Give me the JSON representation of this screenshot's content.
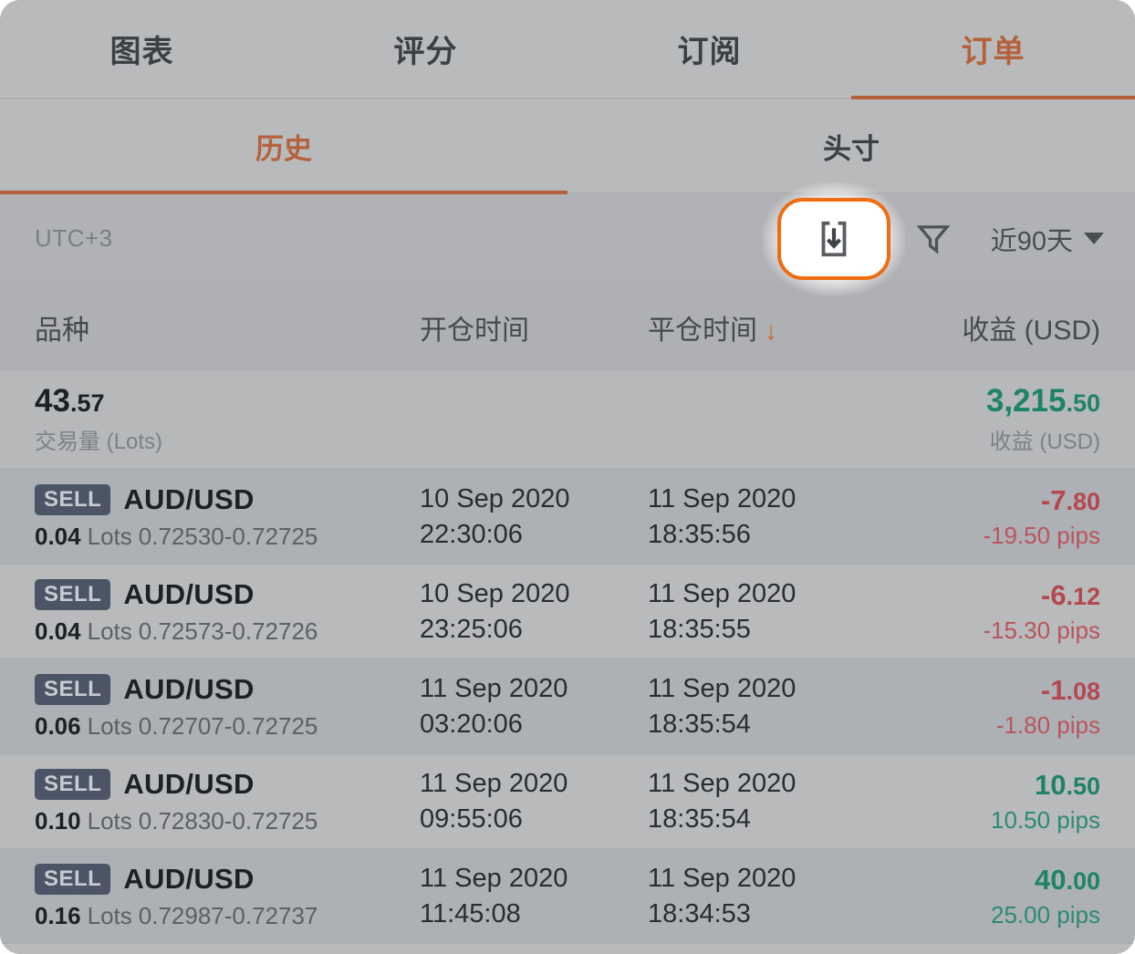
{
  "colors": {
    "accent_orange": "#b4613c",
    "highlight_orange": "#ef6c11",
    "profit_green": "#1f8368",
    "loss_red": "#b5484f",
    "badge_bg": "#4b5566",
    "panel_bg": "#b8babb"
  },
  "tabs": [
    {
      "label": "图表",
      "active": false
    },
    {
      "label": "评分",
      "active": false
    },
    {
      "label": "订阅",
      "active": false
    },
    {
      "label": "订单",
      "active": true
    }
  ],
  "subtabs": [
    {
      "label": "历史",
      "active": true
    },
    {
      "label": "头寸",
      "active": false
    }
  ],
  "toolbar": {
    "timezone": "UTC+3",
    "export_icon": "download-box-icon",
    "filter_icon": "funnel-icon",
    "range_label": "近90天",
    "caret_icon": "chevron-down-icon"
  },
  "columns": {
    "symbol": "品种",
    "open_time": "开仓时间",
    "close_time": "平仓时间",
    "sort_indicator": "↓",
    "profit": "收益 (USD)"
  },
  "summary": {
    "volume_value_int": "43",
    "volume_value_dec": ".57",
    "volume_label": "交易量 (Lots)",
    "profit_value_int": "3,215",
    "profit_value_dec": ".50",
    "profit_label": "收益 (USD)"
  },
  "rows": [
    {
      "side": "SELL",
      "symbol": "AUD/USD",
      "lots": "0.04",
      "lots_word": "Lots",
      "prices": "0.72530-0.72725",
      "open_date": "10 Sep 2020",
      "open_time": "22:30:06",
      "close_date": "11 Sep 2020",
      "close_time": "18:35:56",
      "profit_int": "-7",
      "profit_dec": ".80",
      "pips": "-19.50 pips",
      "sign": "neg"
    },
    {
      "side": "SELL",
      "symbol": "AUD/USD",
      "lots": "0.04",
      "lots_word": "Lots",
      "prices": "0.72573-0.72726",
      "open_date": "10 Sep 2020",
      "open_time": "23:25:06",
      "close_date": "11 Sep 2020",
      "close_time": "18:35:55",
      "profit_int": "-6",
      "profit_dec": ".12",
      "pips": "-15.30 pips",
      "sign": "neg"
    },
    {
      "side": "SELL",
      "symbol": "AUD/USD",
      "lots": "0.06",
      "lots_word": "Lots",
      "prices": "0.72707-0.72725",
      "open_date": "11 Sep 2020",
      "open_time": "03:20:06",
      "close_date": "11 Sep 2020",
      "close_time": "18:35:54",
      "profit_int": "-1",
      "profit_dec": ".08",
      "pips": "-1.80 pips",
      "sign": "neg"
    },
    {
      "side": "SELL",
      "symbol": "AUD/USD",
      "lots": "0.10",
      "lots_word": "Lots",
      "prices": "0.72830-0.72725",
      "open_date": "11 Sep 2020",
      "open_time": "09:55:06",
      "close_date": "11 Sep 2020",
      "close_time": "18:35:54",
      "profit_int": "10",
      "profit_dec": ".50",
      "pips": "10.50 pips",
      "sign": "pos"
    },
    {
      "side": "SELL",
      "symbol": "AUD/USD",
      "lots": "0.16",
      "lots_word": "Lots",
      "prices": "0.72987-0.72737",
      "open_date": "11 Sep 2020",
      "open_time": "11:45:08",
      "close_date": "11 Sep 2020",
      "close_time": "18:34:53",
      "profit_int": "40",
      "profit_dec": ".00",
      "pips": "25.00 pips",
      "sign": "pos"
    }
  ]
}
